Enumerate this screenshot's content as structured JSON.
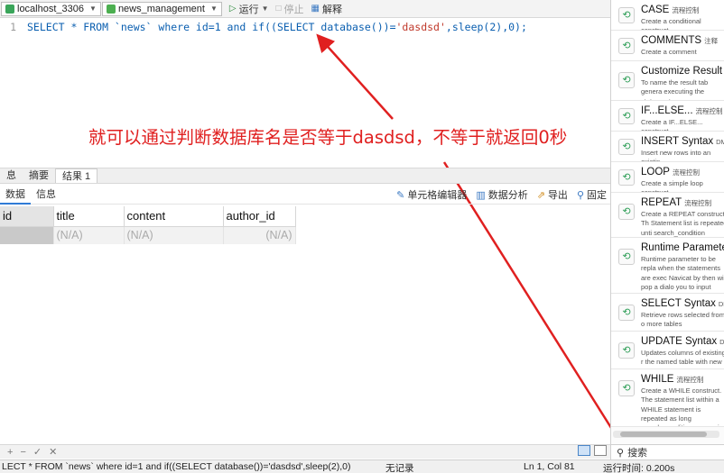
{
  "toolbar": {
    "connection": "localhost_3306",
    "database": "news_management",
    "run_label": "运行",
    "stop_label": "停止",
    "explain_label": "解释"
  },
  "editor": {
    "line_number": "1",
    "code_prefix": "SELECT * FROM `news` where id=1 and if((SELECT database())=",
    "code_string": "'dasdsd'",
    "code_suffix": ",sleep(2),0);"
  },
  "annotation": "就可以通过判断数据库名是否等于dasdsd，不等于就返回0秒",
  "result_tabs": [
    "息",
    "摘要",
    "结果 1"
  ],
  "sub_tabs": [
    "数据",
    "信息"
  ],
  "result_tools": [
    {
      "icon": "cell-editor-icon",
      "label": "单元格编辑器"
    },
    {
      "icon": "data-analysis-icon",
      "label": "数据分析"
    },
    {
      "icon": "export-icon",
      "label": "导出"
    },
    {
      "icon": "pin-icon",
      "label": "固定"
    }
  ],
  "grid": {
    "columns": [
      "id",
      "title",
      "content",
      "author_id"
    ],
    "row": [
      "",
      "(N/A)",
      "(N/A)",
      "(N/A)"
    ]
  },
  "status": {
    "query": "LECT * FROM `news` where id=1 and if((SELECT database())='dasdsd',sleep(2),0)",
    "records": "无记录",
    "position": "Ln 1, Col 81",
    "time": "运行时间: 0.200s"
  },
  "panel_search_label": "搜索",
  "snippets": [
    {
      "title": "CASE",
      "tag": "流程控制",
      "desc": "Create a conditional construct"
    },
    {
      "title": "COMMENTS",
      "tag": "注释",
      "desc": "Create a comment"
    },
    {
      "title": "Customize Result Ta",
      "tag": "",
      "desc": "To name the result tab genera executing the statement."
    },
    {
      "title": "IF...ELSE...",
      "tag": "流程控制",
      "desc": "Create a IF...ELSE... construct"
    },
    {
      "title": "INSERT Syntax",
      "tag": "DML",
      "desc": "Insert new rows into an existin"
    },
    {
      "title": "LOOP",
      "tag": "流程控制",
      "desc": "Create a simple loop construct"
    },
    {
      "title": "REPEAT",
      "tag": "流程控制",
      "desc": "Create a REPEAT construct. Th Statement list is repeated unti search_condition expression is"
    },
    {
      "title": "Runtime Parameter",
      "tag": "",
      "desc": "Runtime parameter to be repla when the statements are exec Navicat by then will pop a dialo you to input value."
    },
    {
      "title": "SELECT Syntax",
      "tag": "DML",
      "desc": "Retrieve rows selected from o more tables"
    },
    {
      "title": "UPDATE Syntax",
      "tag": "DML",
      "desc": "Updates columns of existing r the named table with new valu"
    },
    {
      "title": "WHILE",
      "tag": "流程控制",
      "desc": "Create a WHILE construct. The statement list within a WHILE statement is repeated as long search_condition expression is"
    }
  ],
  "colors": {
    "accent": "#2f7bd6",
    "annotation_red": "#e02020",
    "keyword_blue": "#0b5fb0",
    "string_red": "#c0392b"
  }
}
